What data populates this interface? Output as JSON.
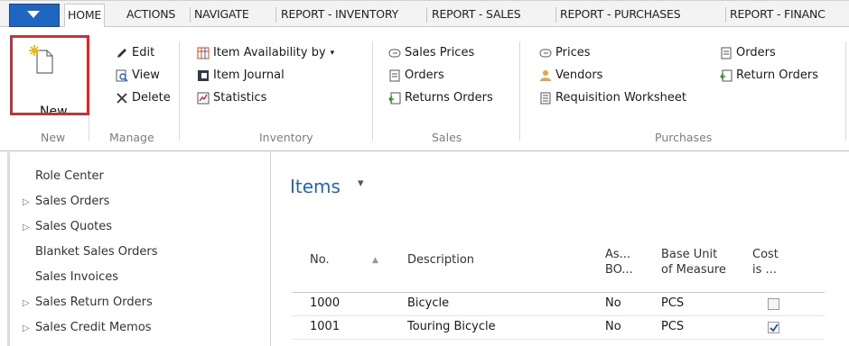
{
  "tabs": [
    {
      "label": "HOME",
      "active": true
    },
    {
      "label": "ACTIONS"
    },
    {
      "label": "NAVIGATE"
    },
    {
      "label": "REPORT - INVENTORY"
    },
    {
      "label": "REPORT - SALES"
    },
    {
      "label": "REPORT - PURCHASES"
    },
    {
      "label": "REPORT - FINANC"
    }
  ],
  "ribbon": {
    "new": {
      "label": "New",
      "group": "New"
    },
    "manage": {
      "group": "Manage",
      "items": [
        "Edit",
        "View",
        "Delete"
      ]
    },
    "inventory": {
      "group": "Inventory",
      "items": [
        "Item Availability by",
        "Item Journal",
        "Statistics"
      ]
    },
    "sales": {
      "group": "Sales",
      "items": [
        "Sales Prices",
        "Orders",
        "Returns Orders"
      ]
    },
    "purchases": {
      "group": "Purchases",
      "col1": [
        "Prices",
        "Vendors",
        "Requisition Worksheet"
      ],
      "col2": [
        "Orders",
        "Return Orders"
      ]
    }
  },
  "nav": {
    "items": [
      {
        "label": "Role Center",
        "expandable": false
      },
      {
        "label": "Sales Orders",
        "expandable": true
      },
      {
        "label": "Sales Quotes",
        "expandable": true
      },
      {
        "label": "Blanket Sales Orders",
        "expandable": false
      },
      {
        "label": "Sales Invoices",
        "expandable": false
      },
      {
        "label": "Sales Return Orders",
        "expandable": true
      },
      {
        "label": "Sales Credit Memos",
        "expandable": true
      }
    ]
  },
  "page": {
    "title": "Items",
    "title_caret": "▾"
  },
  "table": {
    "headers": {
      "no": "No.",
      "description": "Description",
      "assembly_line1": "As...",
      "assembly_line2": "BO...",
      "base_unit_line1": "Base Unit",
      "base_unit_line2": "of Measure",
      "cost_line1": "Cost",
      "cost_line2": "is ..."
    },
    "rows": [
      {
        "no": "1000",
        "description": "Bicycle",
        "assembly": "No",
        "unit": "PCS",
        "cost_checked": false
      },
      {
        "no": "1001",
        "description": "Touring Bicycle",
        "assembly": "No",
        "unit": "PCS",
        "cost_checked": true
      }
    ]
  },
  "colors": {
    "accent": "#1f66c2",
    "highlight": "#e0272b"
  }
}
